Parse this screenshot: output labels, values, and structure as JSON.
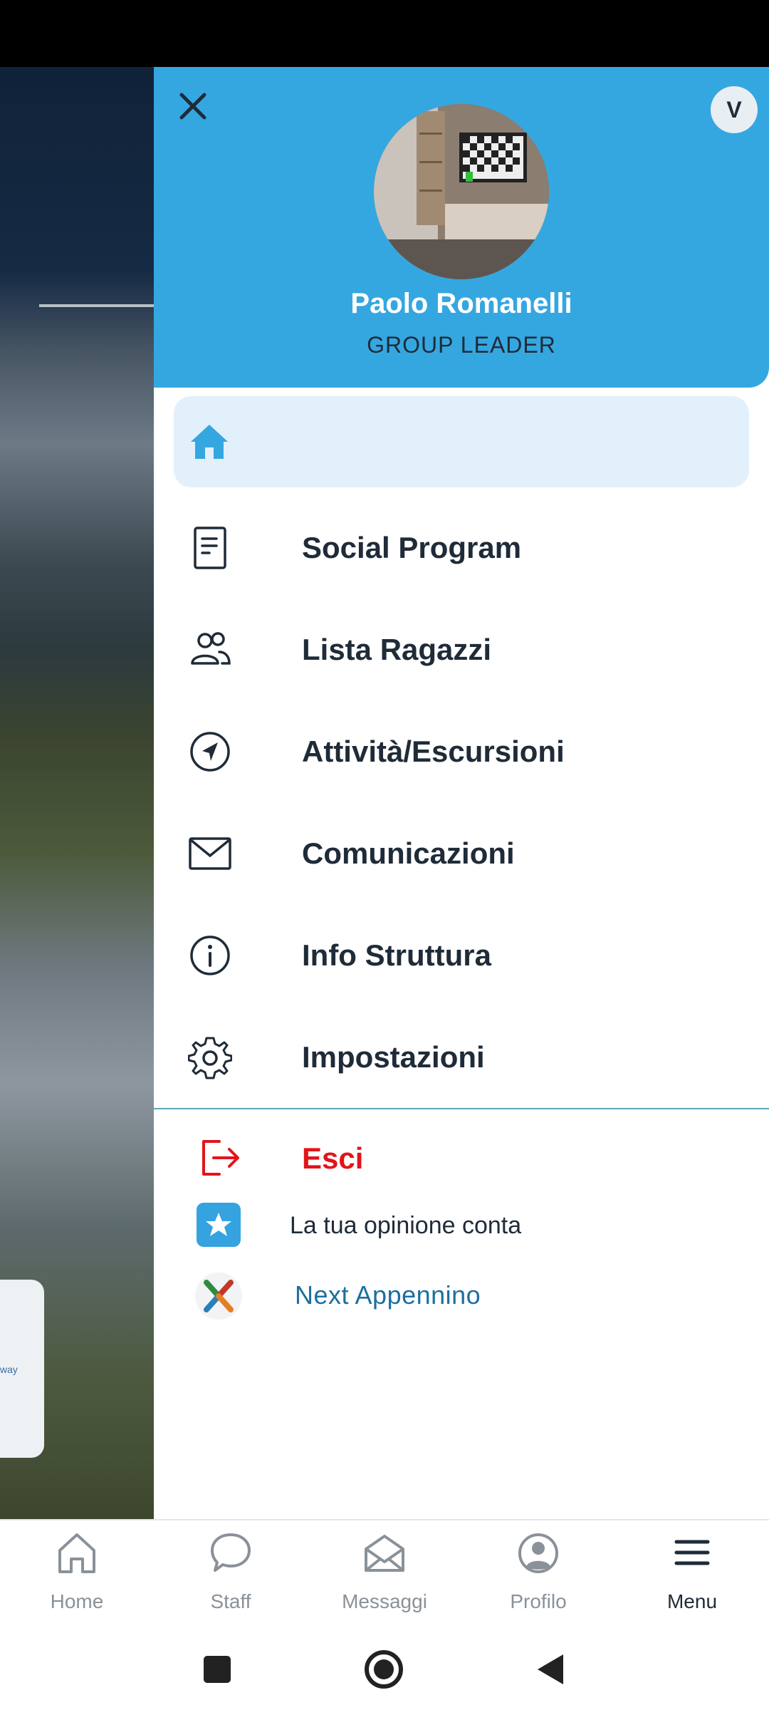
{
  "drawer": {
    "user_name": "Paolo Romanelli",
    "user_role": "GROUP LEADER",
    "avatar_initial": "V",
    "home_icon": "home-icon",
    "items": [
      {
        "label": "Social Program",
        "icon": "document-icon"
      },
      {
        "label": "Lista Ragazzi",
        "icon": "people-icon"
      },
      {
        "label": "Attività/Escursioni",
        "icon": "compass-icon"
      },
      {
        "label": "Comunicazioni",
        "icon": "mail-icon"
      },
      {
        "label": "Info Struttura",
        "icon": "info-icon"
      },
      {
        "label": "Impostazioni",
        "icon": "settings-icon"
      }
    ],
    "logout_label": "Esci",
    "opinion_label": "La tua opinione conta",
    "next_label": "Next Appennino",
    "background_card_text": "way"
  },
  "bottom_nav": {
    "items": [
      {
        "label": "Home",
        "icon": "home-icon"
      },
      {
        "label": "Staff",
        "icon": "chat-icon"
      },
      {
        "label": "Messaggi",
        "icon": "envelope-icon"
      },
      {
        "label": "Profilo",
        "icon": "profile-icon"
      },
      {
        "label": "Menu",
        "icon": "menu-icon"
      }
    ],
    "active": "Menu"
  },
  "colors": {
    "header_blue": "#35a7e0",
    "home_highlight": "#e2f0fc",
    "logout_red": "#e2141b",
    "text_dark": "#1f2b38",
    "link_blue": "#1c6fa0"
  }
}
